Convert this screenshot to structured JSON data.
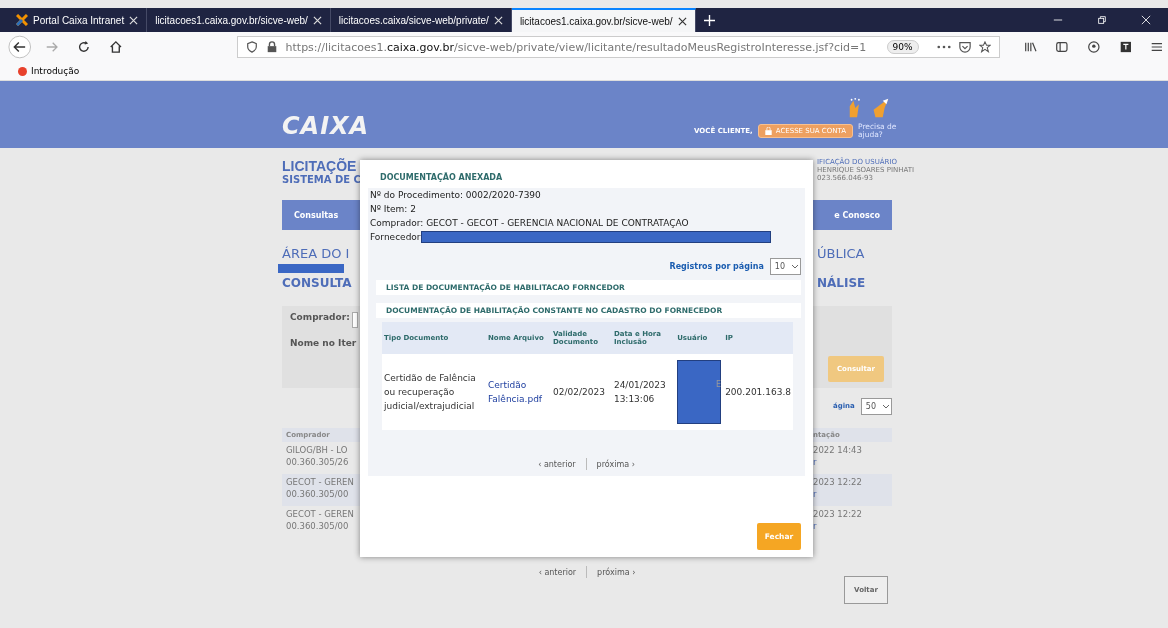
{
  "browser": {
    "tabs": [
      {
        "label": "Portal Caixa Intranet",
        "selected": false
      },
      {
        "label": "licitacoes1.caixa.gov.br/sicve-web/",
        "selected": false
      },
      {
        "label": "licitacoes.caixa/sicve-web/private/",
        "selected": false
      },
      {
        "label": "licitacoes1.caixa.gov.br/sicve-web/",
        "selected": true
      }
    ],
    "url": {
      "prefix": "https://licitacoes1.",
      "domain": "caixa.gov.br",
      "path": "/sicve-web/private/view/licitante/resultadoMeusRegistroInteresse.jsf?cid=1"
    },
    "zoom": "90%",
    "bookmarks": [
      "Introdução"
    ]
  },
  "header": {
    "logo": "CAIXA",
    "client_label": "VOCÊ CLIENTE,",
    "account_button": "ACESSE SUA CONTA",
    "help": "Precisa de ajuda?"
  },
  "page": {
    "title_fragment": "LICITAÇÕE",
    "subtitle_fragment": "SISTEMA DE C",
    "user_label": "IFICAÇÃO DO USUÁRIO",
    "user_name": "HENRIQUE SOARES PINHATI",
    "user_id": "023.566.046-93",
    "nav": [
      "Consultas",
      "e Conosco"
    ],
    "area_fragment": "ÁREA DO I",
    "area_right": "ÚBLICA",
    "consulta_fragment": "CONSULTA",
    "consulta_right": "NÁLISE",
    "filters": [
      "Comprador:",
      "Nome no Iter"
    ],
    "consult_button": "Consultar",
    "per_page_fragment": "ágina",
    "per_page_value": "50",
    "table": {
      "columns": [
        "Comprador",
        "ntação"
      ],
      "rows": [
        {
          "comprador": "GILOG/BH - LO",
          "cnpj": "00.360.305/26",
          "date": "2022 14:43",
          "link": "r"
        },
        {
          "comprador": "GECOT - GEREN",
          "cnpj": "00.360.305/00",
          "date": "2023 12:22",
          "link": "r"
        },
        {
          "comprador": "GECOT - GEREN",
          "cnpj": "00.360.305/00",
          "date": "2023 12:22",
          "link": "r"
        }
      ]
    },
    "pager": {
      "prev": "‹ anterior",
      "next": "próxima ›"
    },
    "back_button": "Voltar"
  },
  "modal": {
    "title": "DOCUMENTAÇÃO ANEXADA",
    "info": [
      "Nº do Procedimento: 0002/2020-7390",
      "Nº Item: 2",
      "Comprador: GECOT - GECOT - GERENCIA NACIONAL DE CONTRATAÇAO"
    ],
    "supplier_label": "Fornecedor",
    "per_page_label": "Registros por página",
    "per_page_value": "10",
    "list_title": "LISTA DE DOCUMENTAÇÃO DE HABILITACAO FORNCEDOR",
    "section_title": "DOCUMENTAÇÃO DE HABILITAÇÃO CONSTANTE NO CADASTRO DO FORNECEDOR",
    "columns": [
      "Tipo Documento",
      "Nome Arquivo",
      "Validade Documento",
      "Data e Hora Inclusão",
      "Usuário",
      "IP"
    ],
    "rows": [
      {
        "tipo": "Certidão de Falência ou recuperação judicial/extrajudicial",
        "arquivo": "Certidão Falência.pdf",
        "validade": "02/02/2023",
        "inclusao": "24/01/2023 13:13:06",
        "usuario": "E",
        "ip": "200.201.163.8"
      }
    ],
    "pager": {
      "prev": "‹ anterior",
      "next": "próxima ›"
    },
    "close_button": "Fechar"
  }
}
